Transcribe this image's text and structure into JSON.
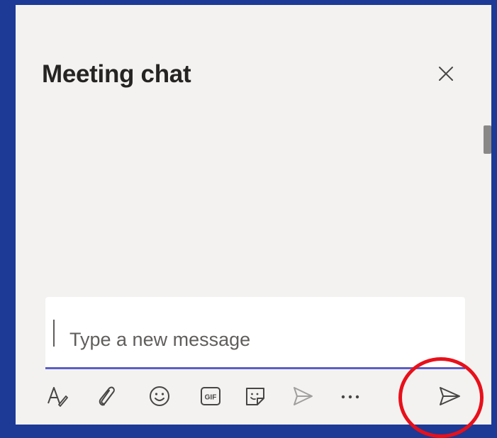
{
  "chat": {
    "title": "Meeting chat",
    "compose": {
      "placeholder": "Type a new message",
      "value": ""
    }
  },
  "toolbar": {
    "items": [
      {
        "name": "format-icon",
        "label": "Format"
      },
      {
        "name": "attach-icon",
        "label": "Attach"
      },
      {
        "name": "emoji-icon",
        "label": "Emoji"
      },
      {
        "name": "gif-icon",
        "label": "GIF"
      },
      {
        "name": "sticker-icon",
        "label": "Sticker"
      },
      {
        "name": "schedule-send-icon",
        "label": "Schedule send"
      },
      {
        "name": "more-options-icon",
        "label": "More options"
      },
      {
        "name": "send-icon",
        "label": "Send"
      }
    ],
    "gif_text": "GIF"
  },
  "highlight": {
    "target": "send-button",
    "color": "#e8101a"
  },
  "colors": {
    "background": "#1c3a96",
    "panel": "#f3f2f1",
    "accent": "#5b5fc7"
  }
}
